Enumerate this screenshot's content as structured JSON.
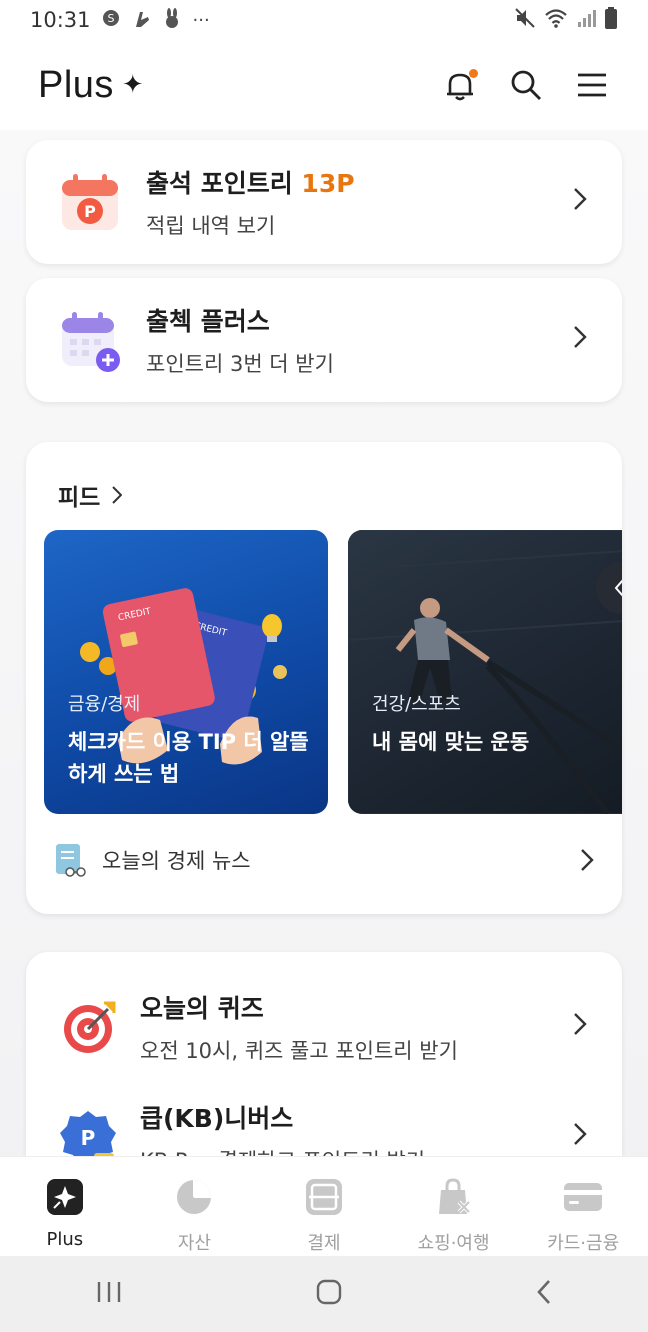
{
  "status_bar": {
    "time": "10:31",
    "more": "···"
  },
  "header": {
    "title": "Plus",
    "star": "✦"
  },
  "attendance": {
    "title_prefix": "출석 포인트리 ",
    "points": "13P",
    "subtitle": "적립 내역 보기"
  },
  "check_plus": {
    "title": "출첵 플러스",
    "subtitle": "포인트리 3번 더 받기"
  },
  "feed": {
    "title": "피드",
    "cards": [
      {
        "category": "금융/경제",
        "title": "체크카드 이용 TIP 더 알뜰하게 쓰는 법"
      },
      {
        "category": "건강/스포츠",
        "title": "내 몸에 맞는 운동"
      }
    ],
    "news_label": "오늘의 경제 뉴스"
  },
  "quiz": {
    "title": "오늘의 퀴즈",
    "subtitle": "오전 10시, 퀴즈 풀고 포인트리 받기"
  },
  "kb_biz": {
    "title": "큽(KB)니버스",
    "subtitle": "KB Pay 결제하고 포인트리 받기"
  },
  "nav": {
    "items": [
      {
        "label": "Plus"
      },
      {
        "label": "자산"
      },
      {
        "label": "결제"
      },
      {
        "label": "쇼핑·여행"
      },
      {
        "label": "카드·금융"
      }
    ]
  },
  "colors": {
    "accent": "#e8760e",
    "notification_dot": "#f07a1a"
  }
}
